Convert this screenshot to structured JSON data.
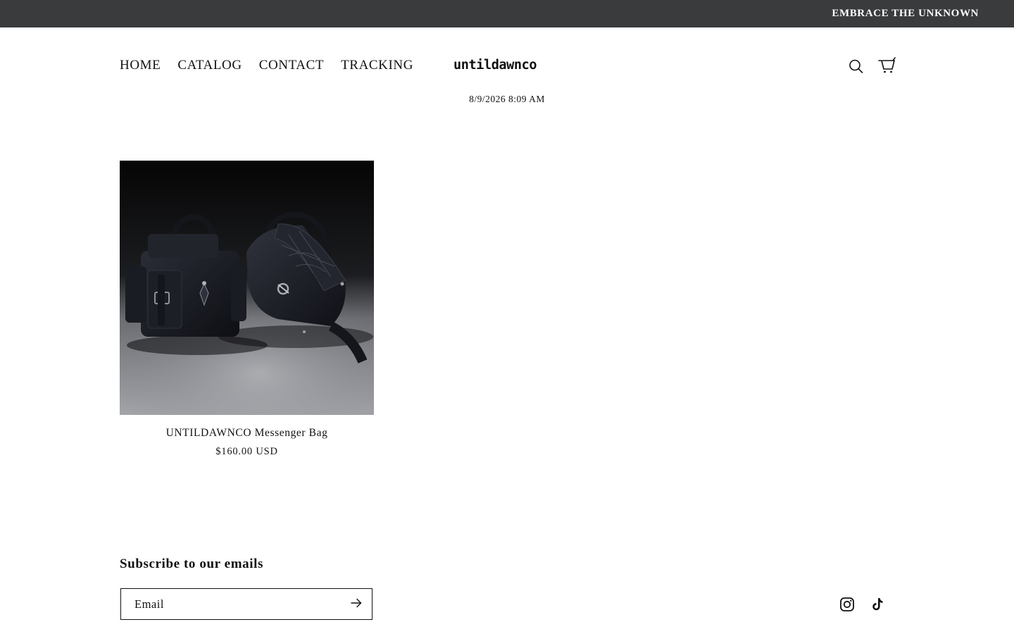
{
  "announcement": {
    "text": "EMBRACE THE UNKNOWN"
  },
  "header": {
    "nav": [
      {
        "label": "HOME"
      },
      {
        "label": "CATALOG"
      },
      {
        "label": "CONTACT"
      },
      {
        "label": "TRACKING"
      }
    ],
    "logo_text": "untildawnco",
    "icons": {
      "search": "search-icon",
      "cart": "cart-icon"
    }
  },
  "datetime": "8/9/2026 8:09 AM",
  "products": [
    {
      "title": "UNTILDAWNCO Messenger Bag",
      "price": "$160.00 USD",
      "image_icon": "product-photo-black-leather-bags"
    }
  ],
  "footer": {
    "newsletter_heading": "Subscribe to our emails",
    "email_placeholder": "Email",
    "submit_icon": "arrow-right-icon",
    "social_icons": [
      "instagram-icon",
      "tiktok-icon"
    ]
  },
  "colors": {
    "announcement_bg": "#3a3b3d",
    "announcement_text": "#ffffff",
    "text": "#121212",
    "background": "#ffffff"
  }
}
